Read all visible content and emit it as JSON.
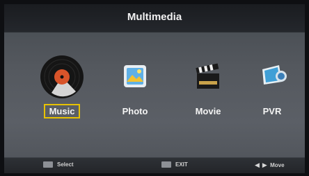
{
  "screen": {
    "title": "Multimedia"
  },
  "menu": {
    "items": [
      {
        "label": "Music",
        "icon": "vinyl-record-icon",
        "selected": true
      },
      {
        "label": "Photo",
        "icon": "photo-icon",
        "selected": false
      },
      {
        "label": "Movie",
        "icon": "clapperboard-icon",
        "selected": false
      },
      {
        "label": "PVR",
        "icon": "pvr-recorder-icon",
        "selected": false
      }
    ]
  },
  "footer": {
    "select_label": "Select",
    "exit_label": "EXIT",
    "move_label": "Move"
  },
  "colors": {
    "selection_border": "#e8c200",
    "title_bar": "#1a1c20",
    "background": "#55595f"
  }
}
